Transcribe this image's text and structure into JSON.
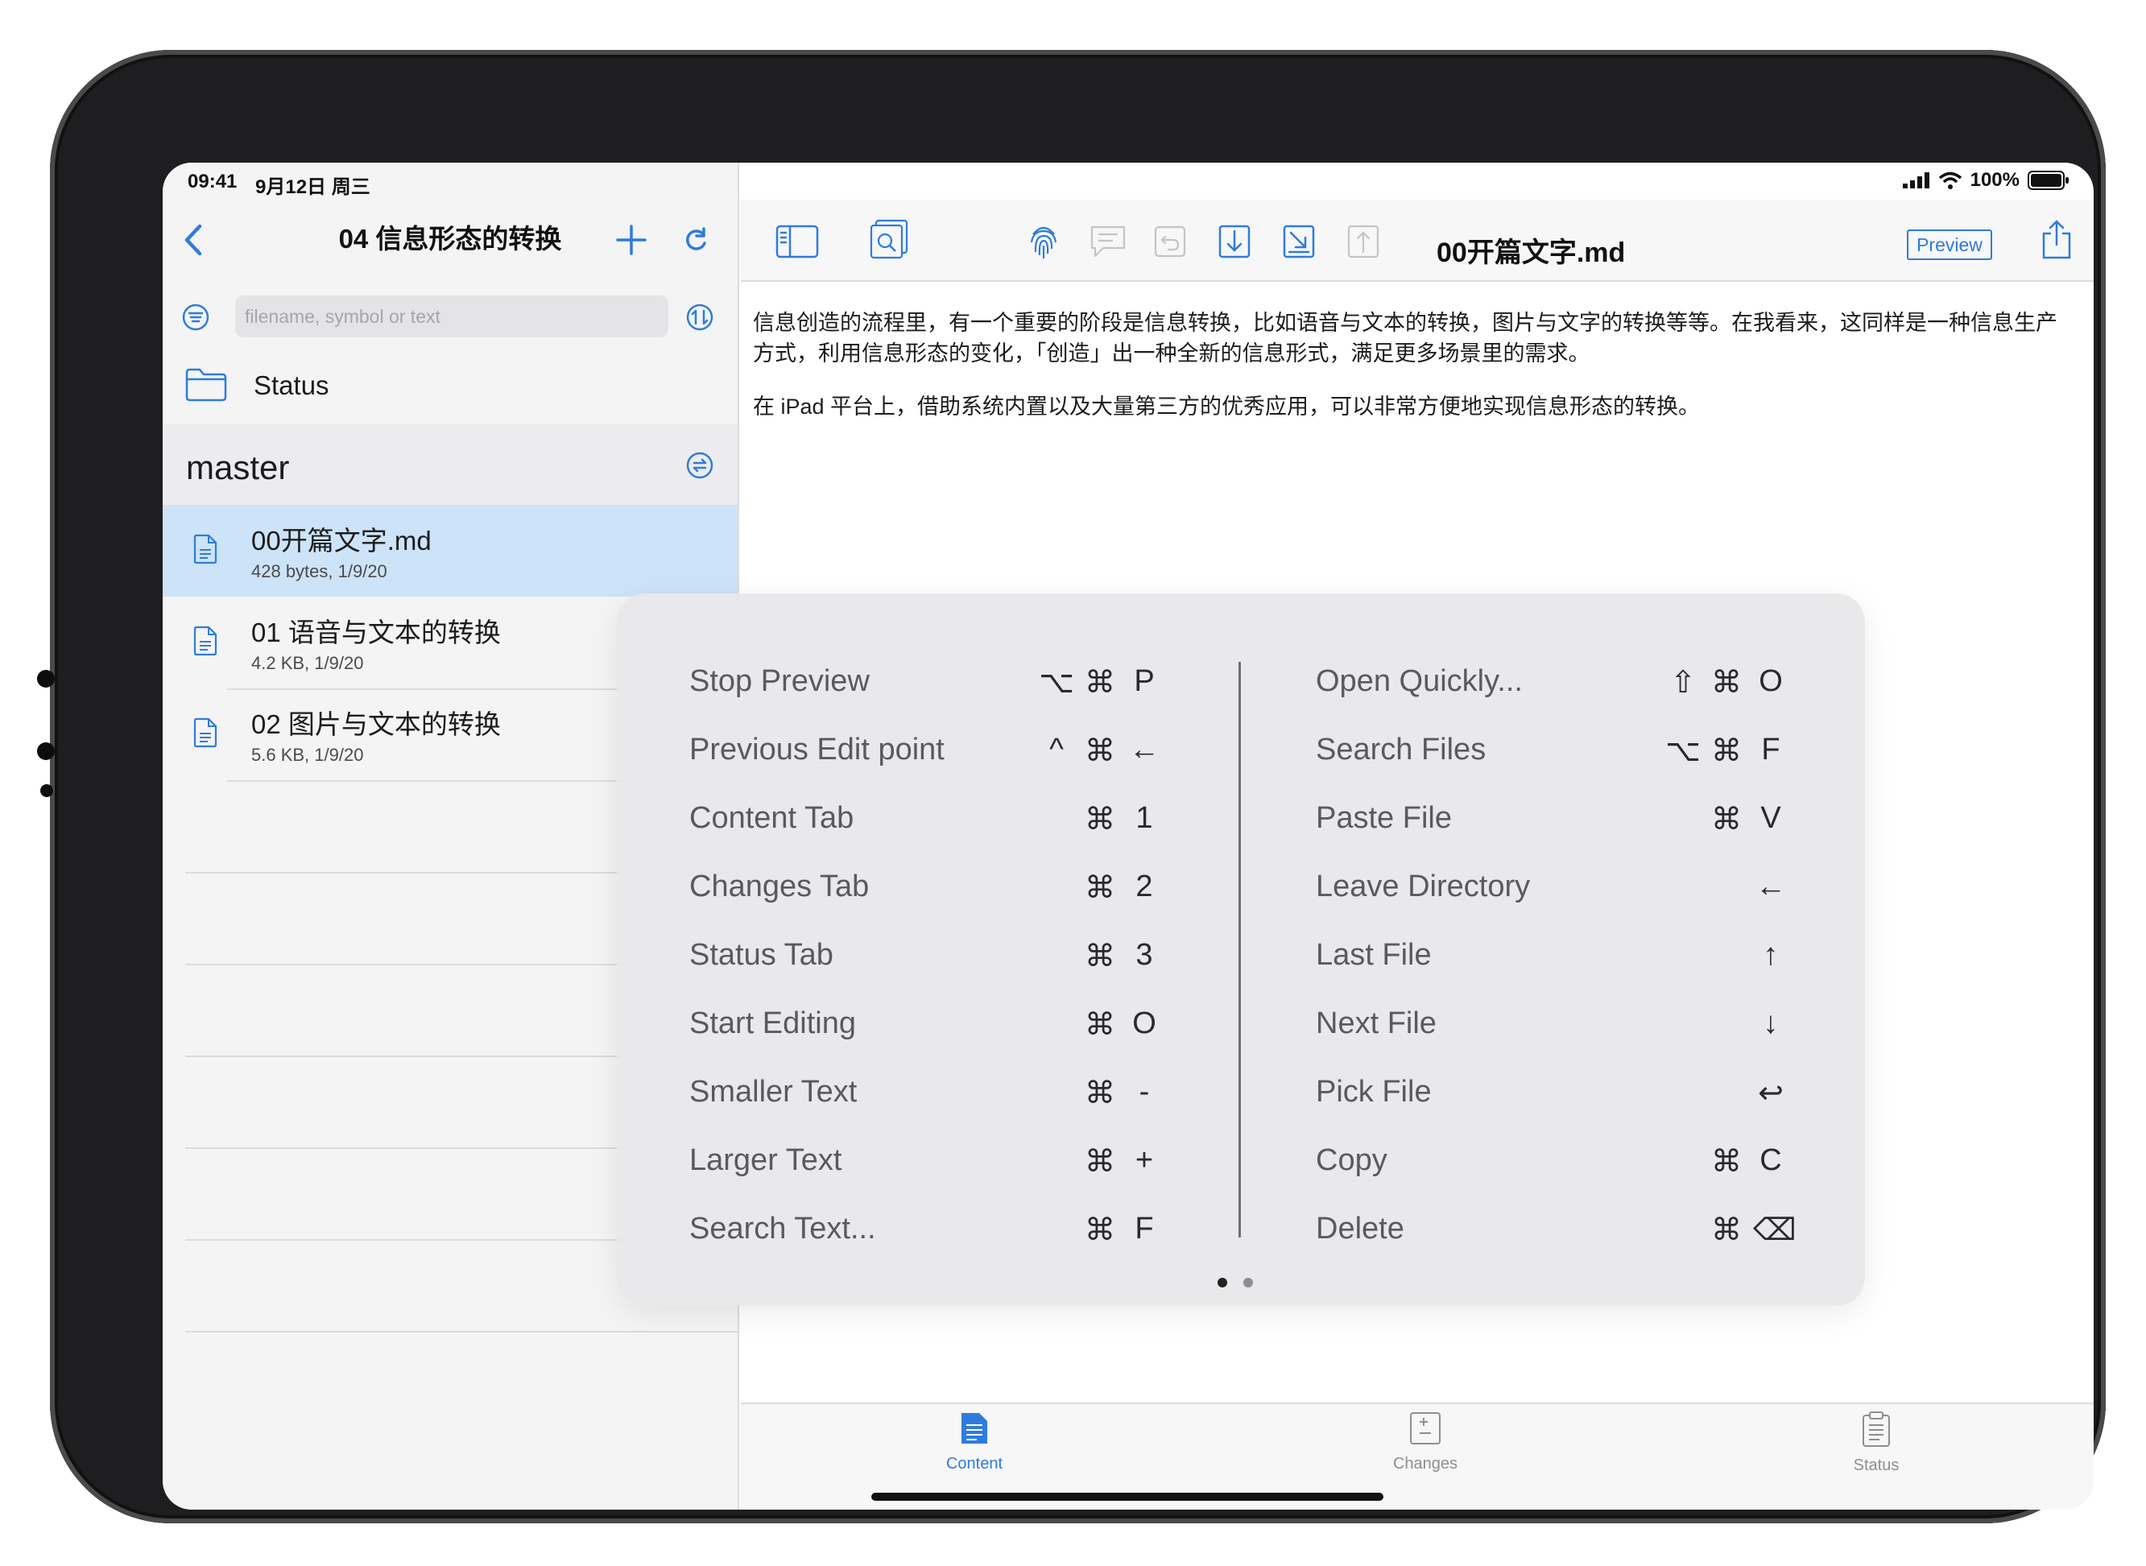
{
  "status_bar": {
    "time": "09:41",
    "date": "9月12日 周三",
    "battery": "100%"
  },
  "sidebar": {
    "title": "04 信息形态的转换",
    "search_placeholder": "filename, symbol or text",
    "status_label": "Status",
    "branch": "master",
    "files": [
      {
        "name": "00开篇文字.md",
        "meta": "428 bytes, 1/9/20",
        "selected": true
      },
      {
        "name": "01 语音与文本的转换",
        "meta": "4.2 KB, 1/9/20",
        "selected": false
      },
      {
        "name": "02 图片与文本的转换",
        "meta": "5.6 KB, 1/9/20",
        "selected": false
      }
    ]
  },
  "toolbar": {
    "doc_title": "00开篇文字.md",
    "preview_label": "Preview"
  },
  "content": {
    "paragraphs": [
      "信息创造的流程里，有一个重要的阶段是信息转换，比如语音与文本的转换，图片与文字的转换等等。在我看来，这同样是一种信息生产方式，利用信息形态的变化，「创造」出一种全新的信息形式，满足更多场景里的需求。",
      "在 iPad 平台上，借助系统内置以及大量第三方的优秀应用，可以非常方便地实现信息形态的转换。"
    ]
  },
  "shortcuts": {
    "left": [
      {
        "name": "Stop Preview",
        "keys": [
          "⌥",
          "⌘",
          "P"
        ]
      },
      {
        "name": "Previous Edit point",
        "keys": [
          "^",
          "⌘",
          "←"
        ]
      },
      {
        "name": "Content Tab",
        "keys": [
          "",
          "⌘",
          "1"
        ]
      },
      {
        "name": "Changes Tab",
        "keys": [
          "",
          "⌘",
          "2"
        ]
      },
      {
        "name": "Status Tab",
        "keys": [
          "",
          "⌘",
          "3"
        ]
      },
      {
        "name": "Start Editing",
        "keys": [
          "",
          "⌘",
          "O"
        ]
      },
      {
        "name": "Smaller Text",
        "keys": [
          "",
          "⌘",
          "-"
        ]
      },
      {
        "name": "Larger Text",
        "keys": [
          "",
          "⌘",
          "+"
        ]
      },
      {
        "name": "Search Text...",
        "keys": [
          "",
          "⌘",
          "F"
        ]
      }
    ],
    "right": [
      {
        "name": "Open Quickly...",
        "keys": [
          "⇧",
          "⌘",
          "O"
        ]
      },
      {
        "name": "Search Files",
        "keys": [
          "⌥",
          "⌘",
          "F"
        ]
      },
      {
        "name": "Paste File",
        "keys": [
          "",
          "⌘",
          "V"
        ]
      },
      {
        "name": "Leave Directory",
        "keys": [
          "",
          "",
          "←"
        ]
      },
      {
        "name": "Last File",
        "keys": [
          "",
          "",
          "↑"
        ]
      },
      {
        "name": "Next File",
        "keys": [
          "",
          "",
          "↓"
        ]
      },
      {
        "name": "Pick File",
        "keys": [
          "",
          "",
          "↩"
        ]
      },
      {
        "name": "Copy",
        "keys": [
          "",
          "⌘",
          "C"
        ]
      },
      {
        "name": "Delete",
        "keys": [
          "",
          "⌘",
          "⌫"
        ]
      }
    ],
    "page_count": 2,
    "current_page": 1
  },
  "tabs": [
    {
      "label": "Content",
      "active": true
    },
    {
      "label": "Changes",
      "active": false
    },
    {
      "label": "Status",
      "active": false
    }
  ],
  "colors": {
    "accent": "#2f7bdc",
    "selected_row": "#cde3f7",
    "inactive_tab": "#8e8e92"
  }
}
